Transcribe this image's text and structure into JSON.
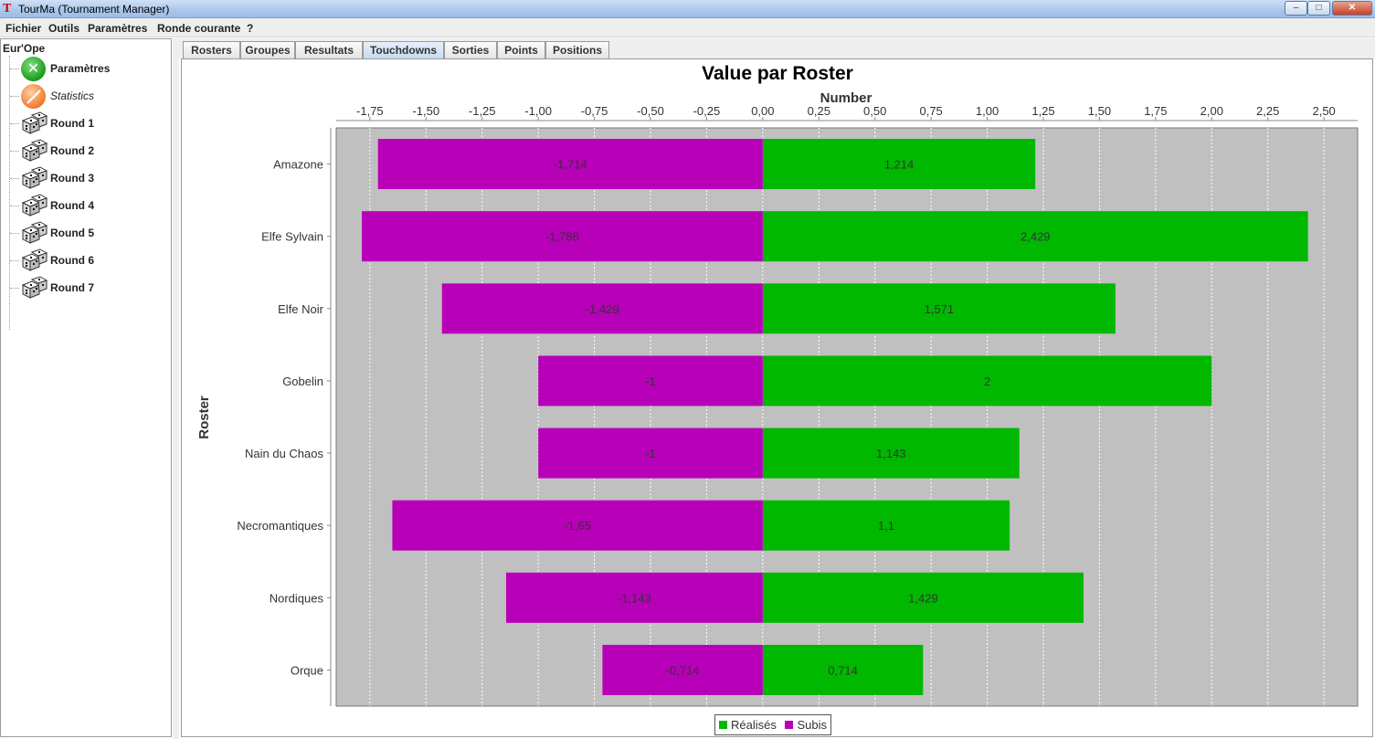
{
  "window": {
    "app_icon": "T",
    "title": "TourMa (Tournament Manager)",
    "controls": {
      "minimize": "–",
      "maximize": "□",
      "close": "✕"
    }
  },
  "menu": [
    "Fichier",
    "Outils",
    "Paramètres",
    "Ronde courante",
    "?"
  ],
  "tree": {
    "root": "Eur'Ope",
    "items": [
      {
        "label": "Paramètres",
        "icon": "wrench-screwdriver-icon",
        "style": "bold"
      },
      {
        "label": "Statistics",
        "icon": "pie-chart-icon",
        "style": "italic"
      },
      {
        "label": "Round 1",
        "icon": "dice-icon",
        "style": "bold"
      },
      {
        "label": "Round 2",
        "icon": "dice-icon",
        "style": "bold"
      },
      {
        "label": "Round 3",
        "icon": "dice-icon",
        "style": "bold"
      },
      {
        "label": "Round 4",
        "icon": "dice-icon",
        "style": "bold"
      },
      {
        "label": "Round 5",
        "icon": "dice-icon",
        "style": "bold"
      },
      {
        "label": "Round 6",
        "icon": "dice-icon",
        "style": "bold"
      },
      {
        "label": "Round 7",
        "icon": "dice-icon",
        "style": "bold"
      }
    ]
  },
  "tabs": [
    "Rosters",
    "Groupes",
    "Resultats",
    "Touchdowns",
    "Sorties",
    "Points",
    "Positions"
  ],
  "active_tab": "Touchdowns",
  "colors": {
    "realises": "#00b800",
    "subis": "#b800b8",
    "plot_bg": "#c0c0c0"
  },
  "chart_data": {
    "type": "bar",
    "orientation": "horizontal",
    "stacked": true,
    "title": "Value par Roster",
    "xlabel": "Number",
    "ylabel": "Roster",
    "xaxis_position": "top",
    "xlim": [
      -1.9,
      2.65
    ],
    "xticks": [
      -1.75,
      -1.5,
      -1.25,
      -1.0,
      -0.75,
      -0.5,
      -0.25,
      0.0,
      0.25,
      0.5,
      0.75,
      1.0,
      1.25,
      1.5,
      1.75,
      2.0,
      2.25,
      2.5
    ],
    "xtick_labels": [
      "-1,75",
      "-1,50",
      "-1,25",
      "-1,00",
      "-0,75",
      "-0,50",
      "-0,25",
      "0,00",
      "0,25",
      "0,50",
      "0,75",
      "1,00",
      "1,25",
      "1,50",
      "1,75",
      "2,00",
      "2,25",
      "2,50"
    ],
    "grid": "vertical dashed",
    "legend_position": "bottom",
    "categories": [
      "Amazone",
      "Elfe Sylvain",
      "Elfe Noir",
      "Gobelin",
      "Nain du Chaos",
      "Necromantiques",
      "Nordiques",
      "Orque"
    ],
    "series": [
      {
        "name": "Réalisés",
        "color": "#00b800",
        "values": [
          1.214,
          2.429,
          1.571,
          2,
          1.143,
          1.1,
          1.429,
          0.714
        ],
        "labels": [
          "1,214",
          "2,429",
          "1,571",
          "2",
          "1,143",
          "1,1",
          "1,429",
          "0,714"
        ]
      },
      {
        "name": "Subis",
        "color": "#b800b8",
        "values": [
          -1.714,
          -1.786,
          -1.429,
          -1,
          -1,
          -1.65,
          -1.143,
          -0.714
        ],
        "labels": [
          "-1,714",
          "-1,786",
          "-1,429",
          "-1",
          "-1",
          "-1,65",
          "-1,143",
          "-0,714"
        ]
      }
    ]
  }
}
